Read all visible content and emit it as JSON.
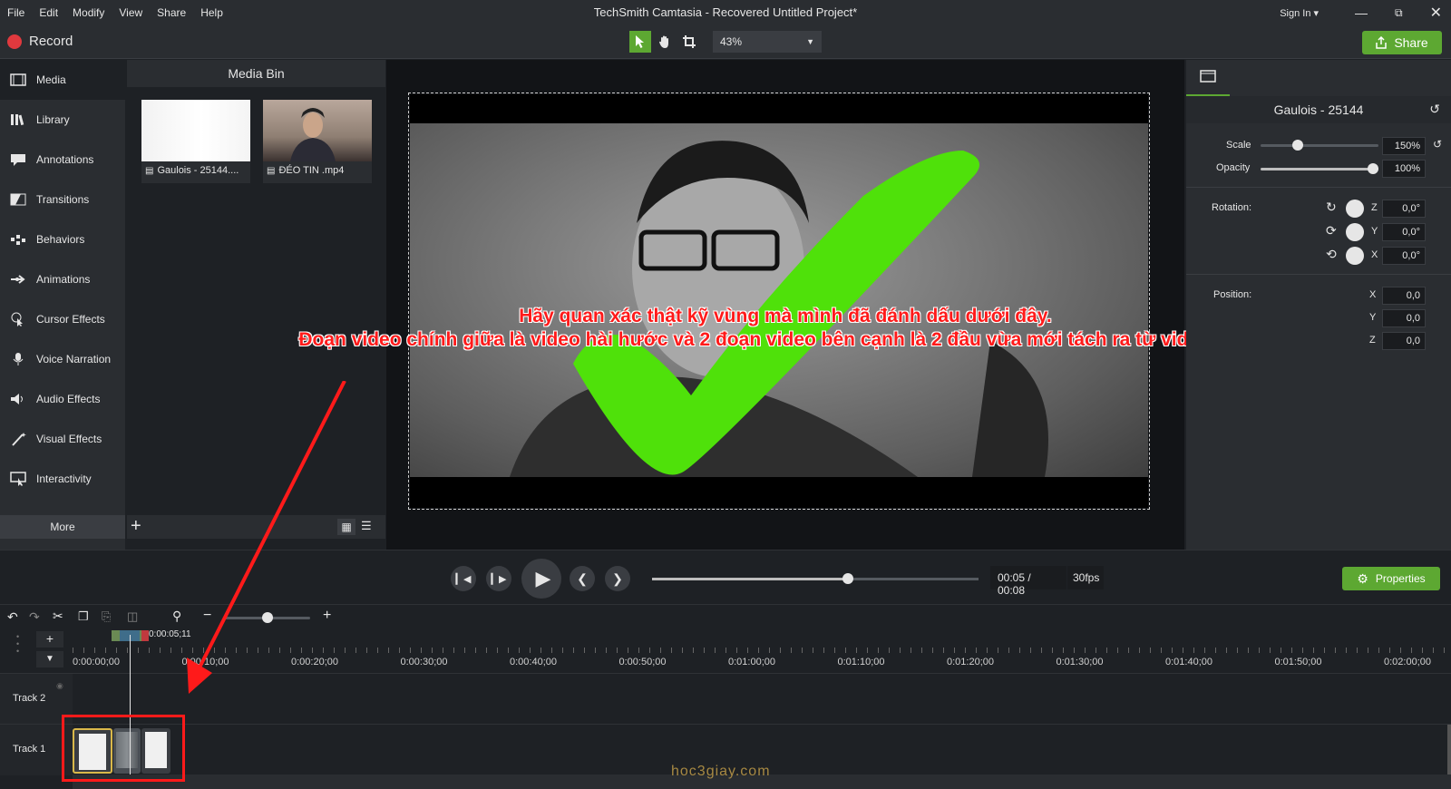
{
  "menu": {
    "items": [
      "File",
      "Edit",
      "Modify",
      "View",
      "Share",
      "Help"
    ],
    "title": "TechSmith Camtasia - Recovered  Untitled Project*",
    "sign_in": "Sign In ▾"
  },
  "toolbar": {
    "record_label": "Record",
    "zoom_value": "43%",
    "share_label": "Share"
  },
  "sidebar": {
    "items": [
      {
        "label": "Media",
        "icon": "film-icon"
      },
      {
        "label": "Library",
        "icon": "library-icon"
      },
      {
        "label": "Annotations",
        "icon": "annotation-icon"
      },
      {
        "label": "Transitions",
        "icon": "transition-icon"
      },
      {
        "label": "Behaviors",
        "icon": "behaviors-icon"
      },
      {
        "label": "Animations",
        "icon": "animation-icon"
      },
      {
        "label": "Cursor Effects",
        "icon": "cursor-icon"
      },
      {
        "label": "Voice Narration",
        "icon": "microphone-icon"
      },
      {
        "label": "Audio Effects",
        "icon": "speaker-icon"
      },
      {
        "label": "Visual Effects",
        "icon": "wand-icon"
      },
      {
        "label": "Interactivity",
        "icon": "interactive-icon"
      }
    ],
    "more_label": "More"
  },
  "media_bin": {
    "title": "Media Bin",
    "items": [
      {
        "name": "Gaulois - 25144...."
      },
      {
        "name": "ĐÉO TIN .mp4"
      }
    ]
  },
  "overlay": {
    "line1": "Hãy quan  xác thật kỹ vùng mà mình đã đánh dấu dưới đây.",
    "line2": "Đoạn video chính giữa là video hài hước và 2 đoạn video bên cạnh là 2 đầu vừa mới tách ra từ video chính.",
    "watermark": "hoc3giay.com"
  },
  "properties": {
    "clip_title": "Gaulois - 25144",
    "scale_label": "Scale",
    "scale_value": "150%",
    "opacity_label": "Opacity",
    "opacity_value": "100%",
    "rotation_label": "Rotation:",
    "rotation": [
      {
        "axis": "Z",
        "value": "0,0°"
      },
      {
        "axis": "Y",
        "value": "0,0°"
      },
      {
        "axis": "X",
        "value": "0,0°"
      }
    ],
    "position_label": "Position:",
    "position": [
      {
        "axis": "X",
        "value": "0,0"
      },
      {
        "axis": "Y",
        "value": "0,0"
      },
      {
        "axis": "Z",
        "value": "0,0"
      }
    ],
    "properties_button": "Properties"
  },
  "playback": {
    "time": "00:05 / 00:08",
    "fps": "30fps",
    "progress": 0.6
  },
  "timeline": {
    "playhead_time": "0:00:05;11",
    "ticks": [
      "0:00:00;00",
      "0:00:10;00",
      "0:00:20;00",
      "0:00:30;00",
      "0:00:40;00",
      "0:00:50;00",
      "0:01:00;00",
      "0:01:10;00",
      "0:01:20;00",
      "0:01:30;00",
      "0:01:40;00",
      "0:01:50;00",
      "0:02:00;00"
    ],
    "tracks": [
      "Track 2",
      "Track 1"
    ]
  }
}
